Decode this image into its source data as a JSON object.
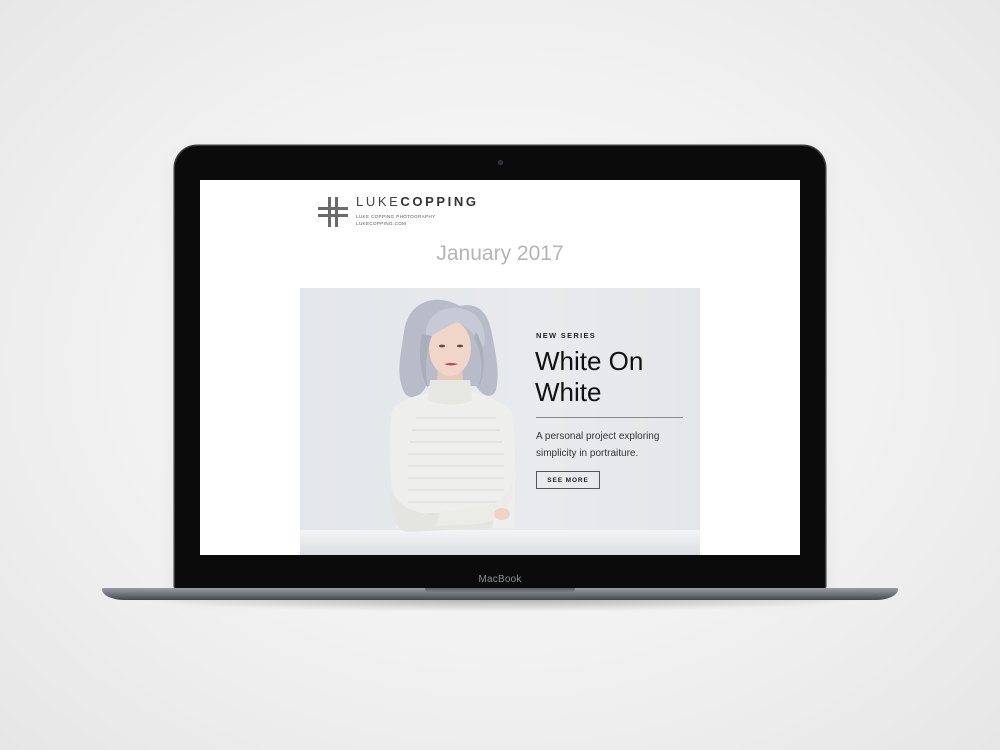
{
  "device": {
    "label": "MacBook"
  },
  "email": {
    "brand": {
      "name_light": "LUKE",
      "name_bold": "COPPING",
      "tagline": "LUKE COPPING PHOTOGRAPHY",
      "website": "LUKECOPPING.COM",
      "logo_icon": "double-cross-logo-icon"
    },
    "issue_date": "January 2017",
    "hero": {
      "eyebrow": "NEW SERIES",
      "title_line1": "White On",
      "title_line2": "White",
      "description": "A personal project exploring simplicity in portraiture.",
      "button_label": "SEE MORE",
      "image": "portrait-photo"
    }
  },
  "colors": {
    "hero_background": "#e6e8eb",
    "date_text": "#b5b5b5",
    "title_text": "#111111"
  }
}
